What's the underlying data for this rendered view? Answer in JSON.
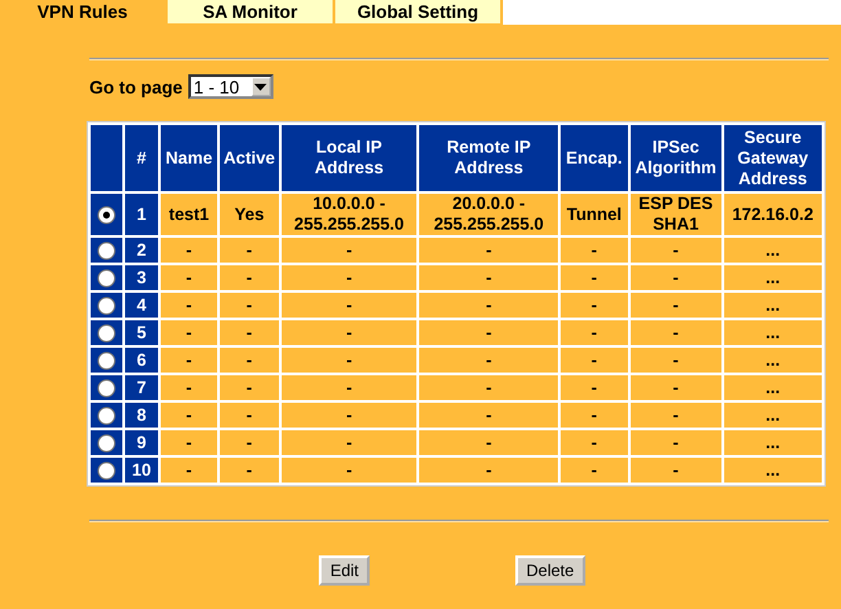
{
  "tabs": [
    {
      "label": "VPN Rules",
      "selected": true
    },
    {
      "label": "SA Monitor",
      "selected": false
    },
    {
      "label": "Global Setting",
      "selected": false
    }
  ],
  "page_select": {
    "label": "Go to page",
    "value": "1 - 10"
  },
  "table": {
    "columns": [
      "#",
      "Name",
      "Active",
      "Local IP Address",
      "Remote IP Address",
      "Encap.",
      "IPSec Algorithm",
      "Secure Gateway Address"
    ],
    "rows": [
      {
        "selected": true,
        "cells": [
          "1",
          "test1",
          "Yes",
          "10.0.0.0 - 255.255.255.0",
          "20.0.0.0 - 255.255.255.0",
          "Tunnel",
          "ESP DES SHA1",
          "172.16.0.2"
        ]
      },
      {
        "selected": false,
        "cells": [
          "2",
          "-",
          "-",
          "-",
          "-",
          "-",
          "-",
          "..."
        ]
      },
      {
        "selected": false,
        "cells": [
          "3",
          "-",
          "-",
          "-",
          "-",
          "-",
          "-",
          "..."
        ]
      },
      {
        "selected": false,
        "cells": [
          "4",
          "-",
          "-",
          "-",
          "-",
          "-",
          "-",
          "..."
        ]
      },
      {
        "selected": false,
        "cells": [
          "5",
          "-",
          "-",
          "-",
          "-",
          "-",
          "-",
          "..."
        ]
      },
      {
        "selected": false,
        "cells": [
          "6",
          "-",
          "-",
          "-",
          "-",
          "-",
          "-",
          "..."
        ]
      },
      {
        "selected": false,
        "cells": [
          "7",
          "-",
          "-",
          "-",
          "-",
          "-",
          "-",
          "..."
        ]
      },
      {
        "selected": false,
        "cells": [
          "8",
          "-",
          "-",
          "-",
          "-",
          "-",
          "-",
          "..."
        ]
      },
      {
        "selected": false,
        "cells": [
          "9",
          "-",
          "-",
          "-",
          "-",
          "-",
          "-",
          "..."
        ]
      },
      {
        "selected": false,
        "cells": [
          "10",
          "-",
          "-",
          "-",
          "-",
          "-",
          "-",
          "..."
        ]
      }
    ]
  },
  "buttons": [
    "Edit",
    "Delete"
  ]
}
